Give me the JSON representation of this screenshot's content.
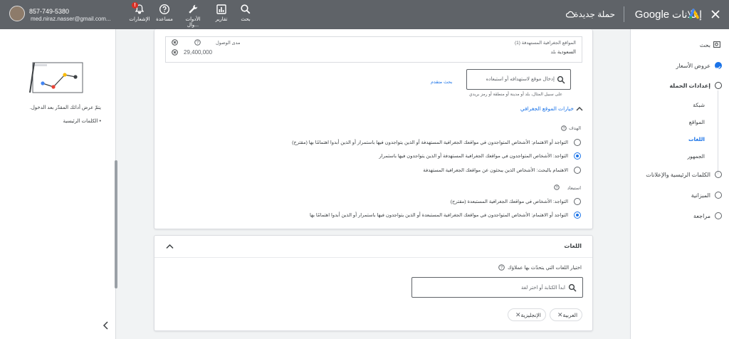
{
  "topbar": {
    "phone": "857-749-5380",
    "email": "med.niraz.nasser@gmail.com...",
    "notifications_badge": "!",
    "tools": [
      {
        "label": "الإشعارات",
        "icon": "bell-icon"
      },
      {
        "label": "مساعدة",
        "icon": "help-icon"
      },
      {
        "label": "الأدوات وال...",
        "icon": "wrench-icon"
      },
      {
        "label": "تقارير",
        "icon": "bar-chart-icon"
      },
      {
        "label": "بحث",
        "icon": "search-icon"
      }
    ],
    "campaign_title": "حملة جديدة",
    "brand": "إعلانات",
    "brand_google": "Google"
  },
  "nav": {
    "search": "بحث",
    "bid_offers": "عروض الأسعار",
    "campaign_settings": "إعدادات الحملة",
    "network": "شبكة",
    "locations": "المواقع",
    "languages": "اللغات",
    "audience": "الجمهور",
    "keywords_ads": "الكلمات الرئيسية والإعلانات",
    "budget": "الميزانية",
    "review": "مراجعة"
  },
  "left": {
    "message": "يتمّ عرض أدائك المقدّر بعد الدخول.",
    "bullet": "الكلمات الرئيسية"
  },
  "locations": {
    "targeted_header": "المواقع الجغرافية المستهدفة (1)",
    "reach_header": "مدى الوصول",
    "target_country": "السعودية",
    "target_type": "بلد",
    "reach_value": "29,400,000",
    "search_placeholder": "إدخال موقع لاستهدافه أو استبعاده",
    "search_hint": "على سبيل المثال، بلد أو مدينة أو منطقة أو رمز بريدي",
    "advanced_search": "بحث متقدم",
    "options_title": "خيارات الموقع الجغرافي",
    "target_label": "الهدف",
    "target_options": [
      "التواجد أو الاهتمام: الأشخاص المتواجدون في مواقعك الجغرافية المستهدفة أو الذين يتواجدون فيها باستمرار أو الذين أبدوا اهتمامًا بها (مقترح)",
      "التواجد: الأشخاص المتواجدون في مواقعك الجغرافية المستهدفة أو الذين يتواجدون فيها باستمرار",
      "الاهتمام بالبحث: الأشخاص الذين يبحثون عن مواقعك الجغرافية المستهدفة"
    ],
    "target_selected": 1,
    "exclude_label": "استبعاد",
    "exclude_options": [
      "التواجد: الأشخاص في مواقعك الجغرافية المستبعدة (مقترح)",
      "التواجد أو الاهتمام: الأشخاص المتواجدون في مواقعك الجغرافية المستبعدة أو الذين يتواجدون فيها باستمرار أو الذين أبدوا اهتمامًا بها"
    ],
    "exclude_selected": 1
  },
  "languages": {
    "title": "اللغات",
    "prompt": "اختيار اللغات التي يتحدّث بها عملاؤك",
    "search_placeholder": "ابدأ الكتابة أو اختر لغة",
    "chips": [
      "العربية",
      "الإنجليزية"
    ]
  },
  "colors": {
    "accent": "#1a73e8",
    "topbar": "#5f6368",
    "badge": "#d93025"
  }
}
